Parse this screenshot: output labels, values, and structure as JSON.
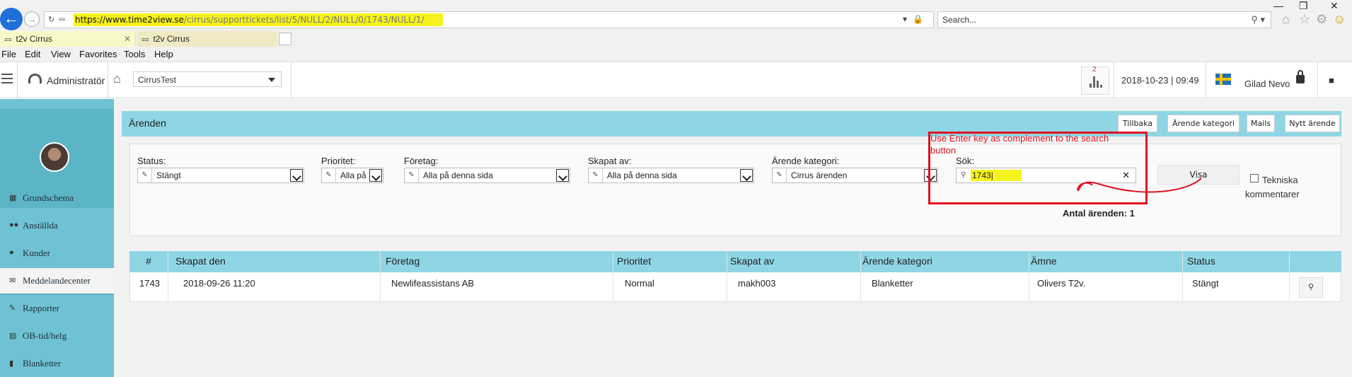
{
  "browser": {
    "url_host": "https://www.time2view.se",
    "url_path": "/cirrus/supporttickets/list/5/NULL/2/NULL/0/1743/NULL/1/",
    "search_placeholder": "Search...",
    "tabs": [
      {
        "label": "t2v Cirrus",
        "active": true
      },
      {
        "label": "t2v Cirrus",
        "active": false
      }
    ],
    "menu": [
      "File",
      "Edit",
      "View",
      "Favorites",
      "Tools",
      "Help"
    ]
  },
  "header": {
    "admin_label": "Administratör",
    "org_select": "CirrusTest",
    "stats_badge": "2",
    "datetime": "2018-10-23 | 09:49",
    "user_name": "Gilad Nevo"
  },
  "sidebar": {
    "items": [
      {
        "label": "Grundschema",
        "icon": "calendar-icon"
      },
      {
        "label": "Anställda",
        "icon": "users-icon"
      },
      {
        "label": "Kunder",
        "icon": "user-icon"
      },
      {
        "label": "Meddelandecenter",
        "icon": "envelope-icon"
      },
      {
        "label": "Rapporter",
        "icon": "pencil-icon"
      },
      {
        "label": "OB-tid/helg",
        "icon": "chart-icon"
      },
      {
        "label": "Blanketter",
        "icon": "document-icon"
      }
    ]
  },
  "panel": {
    "title": "Ärenden",
    "buttons": [
      "Tillbaka",
      "Ärende kategori",
      "Mails",
      "Nytt ärende"
    ]
  },
  "filters": {
    "status_label": "Status:",
    "status_value": "Stängt",
    "priority_label": "Prioritet:",
    "priority_value": "Alla på",
    "company_label": "Företag:",
    "company_value": "Alla på denna sida",
    "created_by_label": "Skapat av:",
    "created_by_value": "Alla på denna sida",
    "category_label": "Ärende kategori:",
    "category_value": "Cirrus ärenden",
    "search_label": "Sök:",
    "search_value": "1743|",
    "show_button": "Visa",
    "tech_comments_label": "Tekniska kommentarer",
    "count_label": "Antal ärenden: 1"
  },
  "annotation": {
    "text": "Use Enter key as complement to the search button",
    "color": "#e0121f"
  },
  "table": {
    "headers": [
      "#",
      "Skapat den",
      "Företag",
      "Prioritet",
      "Skapat av",
      "Ärende kategori",
      "Ämne",
      "Status"
    ],
    "rows": [
      [
        "1743",
        "2018-09-26 11:20",
        "Newlifeassistans AB",
        "Normal",
        "makh003",
        "Blanketter",
        "Olivers T2v.",
        "Stängt"
      ]
    ]
  },
  "colors": {
    "sidebar": "#6ec2d3",
    "header_bar": "#8fd6e5",
    "highlight": "#f6f21b"
  }
}
